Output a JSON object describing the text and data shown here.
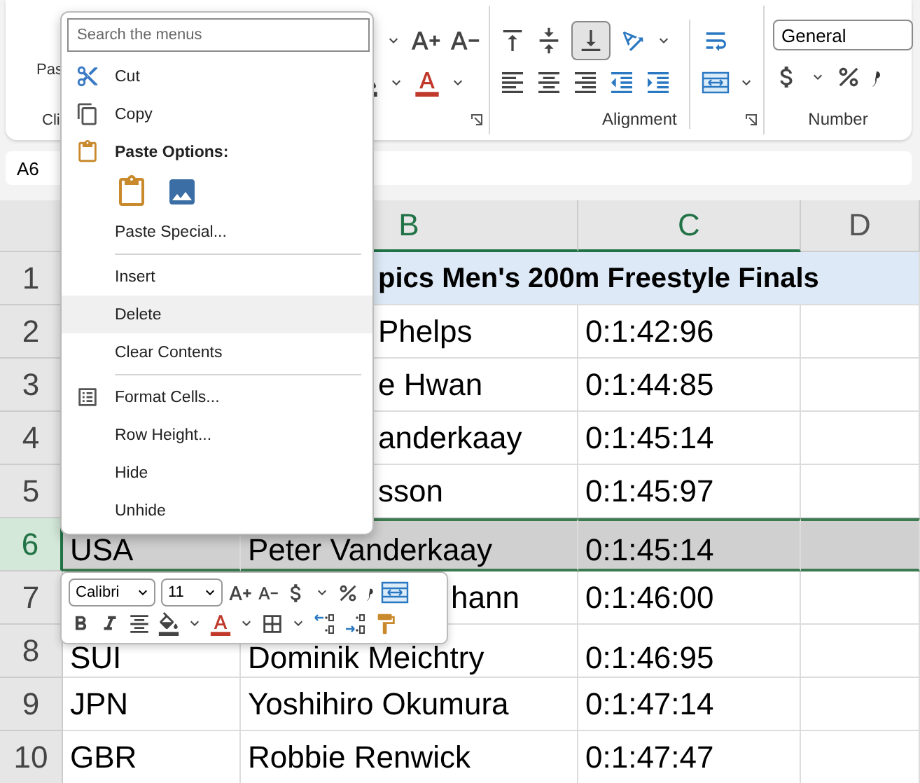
{
  "ribbon": {
    "clipboard": {
      "button_fragment": "Pas",
      "group_fragment": "Cli"
    },
    "alignment": {
      "label": "Alignment",
      "vertical": [
        {
          "selected": false
        },
        {
          "selected": false
        },
        {
          "selected": true
        }
      ]
    },
    "number": {
      "label": "Number",
      "format": "General"
    }
  },
  "name_box": "A6",
  "columns": [
    {
      "label": "B",
      "selected": true
    },
    {
      "label": "C",
      "selected": true
    },
    {
      "label": "D",
      "selected": false
    }
  ],
  "rows": [
    {
      "number": "1",
      "selected": false,
      "kind": "title",
      "cells": [
        "",
        "pics Men's 200m Freestyle Finals"
      ]
    },
    {
      "number": "2",
      "selected": false,
      "kind": "data",
      "cells": [
        "",
        "Phelps",
        "0:1:42:96"
      ]
    },
    {
      "number": "3",
      "selected": false,
      "kind": "data",
      "cells": [
        "",
        "e Hwan",
        "0:1:44:85"
      ]
    },
    {
      "number": "4",
      "selected": false,
      "kind": "data",
      "cells": [
        "",
        "anderkaay",
        "0:1:45:14"
      ]
    },
    {
      "number": "5",
      "selected": false,
      "kind": "data",
      "cells": [
        "",
        "sson",
        "0:1:45:97"
      ]
    },
    {
      "number": "6",
      "selected": true,
      "kind": "data",
      "cells": [
        "USA",
        "Peter Vanderkaay",
        "0:1:45:14"
      ]
    },
    {
      "number": "7",
      "selected": false,
      "kind": "data",
      "cells": [
        "",
        "hann",
        "0:1:46:00"
      ]
    },
    {
      "number": "8",
      "selected": false,
      "kind": "data",
      "cells": [
        "SUI",
        "Dominik Meichtry",
        "0:1:46:95"
      ]
    },
    {
      "number": "9",
      "selected": false,
      "kind": "data",
      "cells": [
        "JPN",
        "Yoshihiro Okumura",
        "0:1:47:14"
      ]
    },
    {
      "number": "10",
      "selected": false,
      "kind": "data",
      "cells": [
        "GBR",
        "Robbie Renwick",
        "0:1:47:47"
      ]
    }
  ],
  "context_menu": {
    "search": {
      "placeholder": "Search the menus"
    },
    "items": [
      {
        "kind": "command",
        "label": "Cut",
        "selected": false,
        "separator_before": false
      },
      {
        "kind": "command",
        "label": "Copy",
        "selected": false,
        "separator_before": false
      },
      {
        "kind": "heading",
        "label": "Paste Options:",
        "separator_before": false
      },
      {
        "kind": "paste_choices",
        "separator_before": false
      },
      {
        "kind": "command",
        "label": "Paste Special...",
        "selected": false,
        "separator_before": false
      },
      {
        "kind": "command",
        "label": "Insert",
        "selected": false,
        "separator_before": true
      },
      {
        "kind": "command",
        "label": "Delete",
        "selected": true,
        "separator_before": false
      },
      {
        "kind": "command",
        "label": "Clear Contents",
        "selected": false,
        "separator_before": false
      },
      {
        "kind": "command",
        "label": "Format Cells...",
        "selected": false,
        "separator_before": true
      },
      {
        "kind": "command",
        "label": "Row Height...",
        "selected": false,
        "separator_before": false
      },
      {
        "kind": "command",
        "label": "Hide",
        "selected": false,
        "separator_before": false
      },
      {
        "kind": "command",
        "label": "Unhide",
        "selected": false,
        "separator_before": false
      }
    ]
  },
  "mini_toolbar": {
    "font": "Calibri",
    "size": "11"
  }
}
